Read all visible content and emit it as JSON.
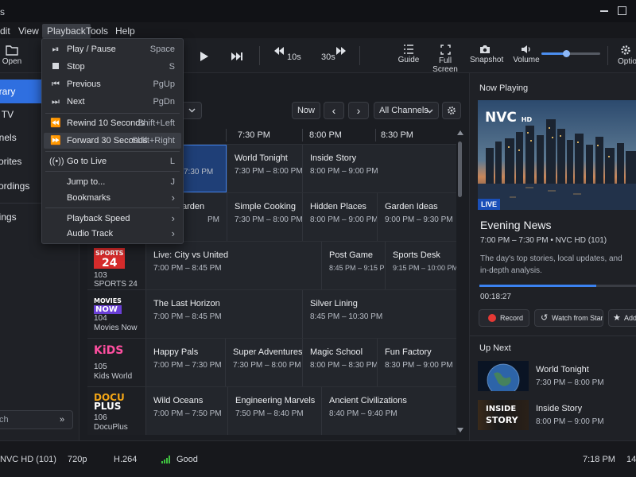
{
  "window": {
    "title_fragment": "s"
  },
  "menubar": {
    "items": [
      "dit",
      "View",
      "Playback",
      "Tools",
      "Help"
    ]
  },
  "toolbar": {
    "open_label": "Open",
    "skip_back_label": "10s",
    "skip_fwd_label": "30s",
    "guide_label": "Guide",
    "fullscreen_label": "Full Screen",
    "snapshot_label": "Snapshot",
    "volume_label": "Volume",
    "options_label": "Optio",
    "volume_level": 0.42
  },
  "playback_menu": {
    "items": [
      {
        "label": "Play / Pause",
        "shortcut": "Space",
        "icon": "play-pause-icon"
      },
      {
        "label": "Stop",
        "shortcut": "S",
        "icon": "stop-icon"
      },
      {
        "label": "Previous",
        "shortcut": "PgUp",
        "icon": "previous-icon"
      },
      {
        "label": "Next",
        "shortcut": "PgDn",
        "icon": "next-icon"
      },
      {
        "label": "Rewind 10 Seconds",
        "shortcut": "Shift+Left",
        "icon": "rewind-icon"
      },
      {
        "label": "Forward 30 Seconds",
        "shortcut": "Shift+Right",
        "icon": "fast-forward-icon"
      },
      {
        "label": "Go to Live",
        "shortcut": "L",
        "icon": "broadcast-icon"
      },
      {
        "label": "Jump to...",
        "shortcut": "J",
        "icon": ""
      },
      {
        "label": "Bookmarks",
        "shortcut": "›",
        "icon": ""
      },
      {
        "label": "Playback Speed",
        "shortcut": "›",
        "icon": ""
      },
      {
        "label": "Audio Track",
        "shortcut": "›",
        "icon": ""
      }
    ]
  },
  "sidebar": {
    "items": [
      "brary",
      "e TV",
      "nnels",
      "vorites",
      "cordings",
      "ttings"
    ],
    "search_placeholder": "ch",
    "collapse_glyph": "»"
  },
  "guide": {
    "title": "",
    "now_label": "Now",
    "prev_glyph": "‹",
    "next_glyph": "›",
    "filter_label": "All Channels",
    "times": [
      "7:30 PM",
      "8:00 PM",
      "8:30 PM"
    ],
    "row1": {
      "p1": {
        "title": "lews",
        "time": "7:30 PM"
      },
      "p2": {
        "title": "World Tonight",
        "time": "7:30 PM – 8:00 PM"
      },
      "p3": {
        "title": "Inside Story",
        "time": "8:00 PM – 9:00 PM"
      }
    },
    "row2": {
      "p1": {
        "title": "arden",
        "time": "PM"
      },
      "p2": {
        "title": "Simple Cooking",
        "time": "7:30 PM – 8:00 PM"
      },
      "p3": {
        "title": "Hidden Places",
        "time": "8:00 PM – 9:00 PM"
      },
      "p4": {
        "title": "Garden Ideas",
        "time": "9:00 PM – 9:30 PM"
      }
    },
    "row3": {
      "logo_top": "SPORTS",
      "logo_bottom": "24",
      "number": "103",
      "name": "SPORTS 24",
      "p1": {
        "title": "Live: City vs United",
        "time": "7:00 PM – 8:45 PM"
      },
      "p2": {
        "title": "Post Game",
        "time": "8:45 PM – 9:15 PM"
      },
      "p3": {
        "title": "Sports Desk",
        "time": "9:15 PM – 10:00 PM"
      }
    },
    "row4": {
      "logo_top": "MOVIES",
      "logo_bottom": "NOW",
      "number": "104",
      "name": "Movies Now",
      "p1": {
        "title": "The Last Horizon",
        "time": "7:00 PM – 8:45 PM"
      },
      "p2": {
        "title": "Silver Lining",
        "time": "8:45 PM – 10:30 PM"
      }
    },
    "row5": {
      "logo": "KiDS",
      "number": "105",
      "name": "Kids World",
      "p1": {
        "title": "Happy Pals",
        "time": "7:00 PM – 7:30 PM"
      },
      "p2": {
        "title": "Super Adventures",
        "time": "7:30 PM – 8:00 PM"
      },
      "p3": {
        "title": "Magic School",
        "time": "8:00 PM – 8:30 PM"
      },
      "p4": {
        "title": "Fun Factory",
        "time": "8:30 PM – 9:00 PM"
      }
    },
    "row6": {
      "logo_top": "DOCU",
      "logo_bottom": "PLUS",
      "number": "106",
      "name": "DocuPlus",
      "p1": {
        "title": "Wild Oceans",
        "time": "7:00 PM – 7:50 PM"
      },
      "p2": {
        "title": "Engineering Marvels",
        "time": "7:50 PM – 8:40 PM"
      },
      "p3": {
        "title": "Ancient Civilizations",
        "time": "8:40 PM – 9:40 PM"
      }
    }
  },
  "now_playing": {
    "header": "Now Playing",
    "channel_logo": "NVC",
    "channel_logo_hd": "HD",
    "live_badge": "LIVE",
    "title": "Evening News",
    "meta": "7:00 PM – 7:30 PM  •  NVC HD (101)",
    "description": "The day's top stories, local updates, and in-depth analysis.",
    "progress": 0.74,
    "elapsed": "00:18:27",
    "record_label": "Record",
    "watch_start_label": "Watch from Start",
    "add_label": "Add t",
    "up_next_header": "Up Next",
    "up_next": [
      {
        "title": "World Tonight",
        "time": "7:30 PM – 8:00 PM"
      },
      {
        "title": "Inside Story",
        "time": "8:00 PM – 9:00 PM"
      }
    ],
    "inside_story_thumb": [
      "INSIDE",
      "STORY"
    ]
  },
  "statusbar": {
    "channel": "NVC HD (101)",
    "resolution": "720p",
    "codec": "H.264",
    "signal": "Good",
    "clock": "7:18 PM",
    "extra": "14"
  },
  "colors": {
    "accent": "#2f6fe0",
    "record": "#e53935",
    "signal": "#3fbf3f"
  }
}
